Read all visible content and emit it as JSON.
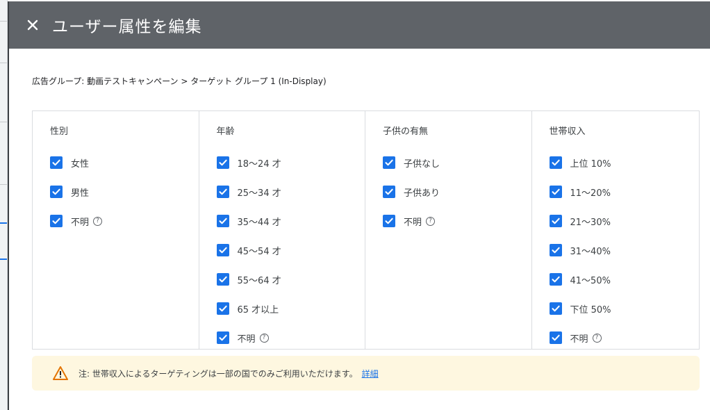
{
  "dialog": {
    "title": "ユーザー属性を編集",
    "close_icon": "close-icon"
  },
  "breadcrumb": "広告グループ: 動画テストキャンペーン > ターゲット グループ 1 (In-Display)",
  "columns": [
    {
      "title": "性別",
      "options": [
        {
          "label": "女性",
          "checked": true
        },
        {
          "label": "男性",
          "checked": true
        },
        {
          "label": "不明",
          "checked": true,
          "help": true
        }
      ]
    },
    {
      "title": "年齢",
      "options": [
        {
          "label": "18〜24 才",
          "checked": true
        },
        {
          "label": "25〜34 才",
          "checked": true
        },
        {
          "label": "35〜44 才",
          "checked": true
        },
        {
          "label": "45〜54 才",
          "checked": true
        },
        {
          "label": "55〜64 才",
          "checked": true
        },
        {
          "label": "65 才以上",
          "checked": true
        },
        {
          "label": "不明",
          "checked": true,
          "help": true
        }
      ]
    },
    {
      "title": "子供の有無",
      "options": [
        {
          "label": "子供なし",
          "checked": true
        },
        {
          "label": "子供あり",
          "checked": true
        },
        {
          "label": "不明",
          "checked": true,
          "help": true
        }
      ]
    },
    {
      "title": "世帯収入",
      "options": [
        {
          "label": "上位 10%",
          "checked": true
        },
        {
          "label": "11〜20%",
          "checked": true
        },
        {
          "label": "21〜30%",
          "checked": true
        },
        {
          "label": "31〜40%",
          "checked": true
        },
        {
          "label": "41〜50%",
          "checked": true
        },
        {
          "label": "下位 50%",
          "checked": true
        },
        {
          "label": "不明",
          "checked": true,
          "help": true
        }
      ]
    }
  ],
  "help_glyph": "?",
  "notice": {
    "text": "注: 世帯収入によるターゲティングは一部の国でのみご利用いただけます。",
    "link": "詳細",
    "icon": "warning-icon"
  },
  "colors": {
    "header_bg": "#5f6368",
    "checkbox": "#1a73e8",
    "notice_bg": "#fef7e0",
    "warning": "#e37400"
  }
}
